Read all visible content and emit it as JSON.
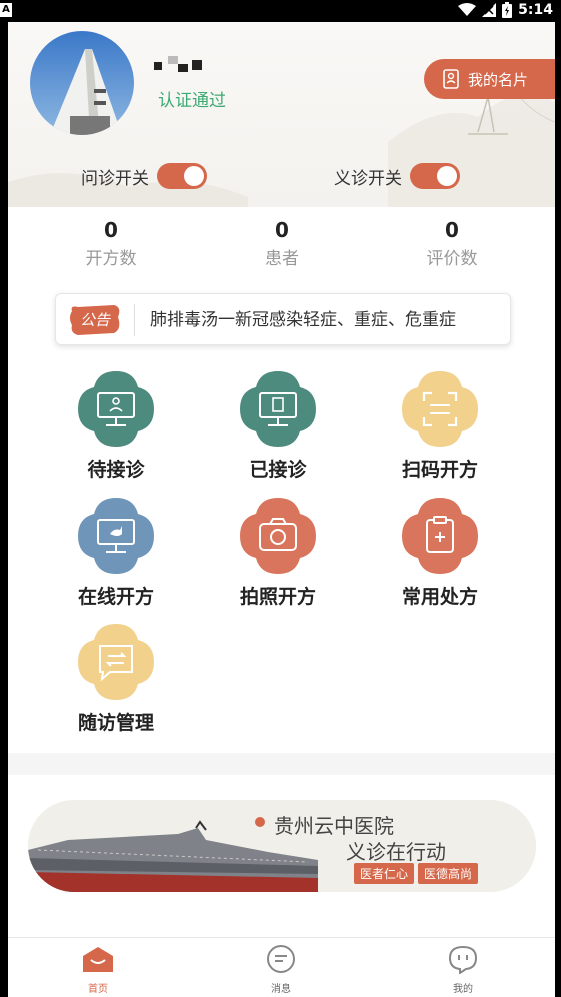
{
  "status_bar": {
    "left_icon": "A",
    "time": "5:14"
  },
  "profile": {
    "verified_text": "认证通过",
    "card_button_label": "我的名片"
  },
  "toggles": [
    {
      "label": "问诊开关",
      "on": true
    },
    {
      "label": "义诊开关",
      "on": true
    }
  ],
  "stats": [
    {
      "value": "0",
      "label": "开方数"
    },
    {
      "value": "0",
      "label": "患者"
    },
    {
      "value": "0",
      "label": "评价数"
    }
  ],
  "notice": {
    "badge_text": "公告",
    "text": "肺排毒汤一新冠感染轻症、重症、危重症"
  },
  "grid": [
    {
      "label": "待接诊",
      "icon": "monitor-person-icon",
      "color": "#4e8b7f"
    },
    {
      "label": "已接诊",
      "icon": "monitor-document-icon",
      "color": "#4e8b7f"
    },
    {
      "label": "扫码开方",
      "icon": "scan-icon",
      "color": "#f2d18d"
    },
    {
      "label": "在线开方",
      "icon": "monitor-bird-icon",
      "color": "#6f95b8"
    },
    {
      "label": "拍照开方",
      "icon": "camera-icon",
      "color": "#d9755d"
    },
    {
      "label": "常用处方",
      "icon": "clipboard-plus-icon",
      "color": "#d9755d"
    },
    {
      "label": "随访管理",
      "icon": "chat-swap-icon",
      "color": "#f2d18d"
    }
  ],
  "banner": {
    "title": "贵州云中医院",
    "subtitle": "义诊在行动",
    "pills": [
      "医者仁心",
      "医德高尚"
    ]
  },
  "tabs": [
    {
      "label": "首页",
      "icon": "home-icon",
      "active": true
    },
    {
      "label": "消息",
      "icon": "message-icon",
      "active": false
    },
    {
      "label": "我的",
      "icon": "profile-icon",
      "active": false
    }
  ],
  "colors": {
    "accent": "#d5674a",
    "verified": "#3eaa73",
    "teal": "#4e8b7f",
    "yellow": "#f2d18d",
    "blue": "#6f95b8"
  }
}
